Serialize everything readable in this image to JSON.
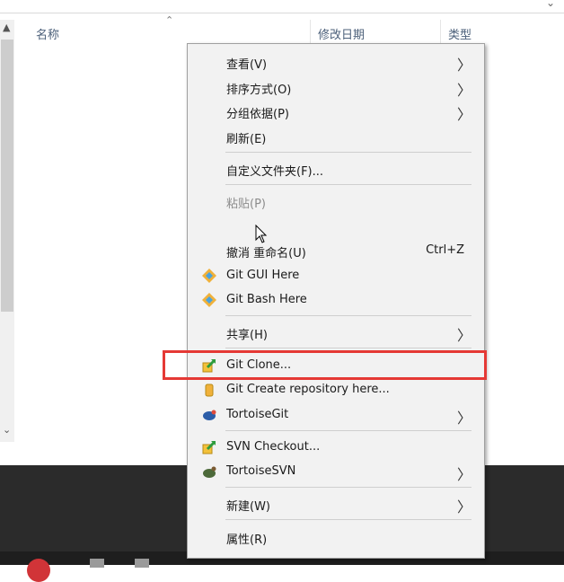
{
  "explorer": {
    "columns": {
      "name": "名称",
      "modified": "修改日期",
      "type": "类型"
    }
  },
  "context_menu": {
    "view": "查看(V)",
    "sort_by": "排序方式(O)",
    "group_by": "分组依据(P)",
    "refresh": "刷新(E)",
    "customize_folder": "自定义文件夹(F)...",
    "paste": "粘贴(P)",
    "undo_rename": "撤消 重命名(U)",
    "undo_shortcut": "Ctrl+Z",
    "git_gui": "Git GUI Here",
    "git_bash": "Git Bash Here",
    "share": "共享(H)",
    "git_clone": "Git Clone...",
    "git_create_repo": "Git Create repository here...",
    "tortoise_git": "TortoiseGit",
    "svn_checkout": "SVN Checkout...",
    "tortoise_svn": "TortoiseSVN",
    "new": "新建(W)",
    "properties": "属性(R)"
  },
  "colors": {
    "highlight": "#e53935",
    "menu_bg": "#f2f2f2",
    "taskbar": "#2b2b2b"
  }
}
